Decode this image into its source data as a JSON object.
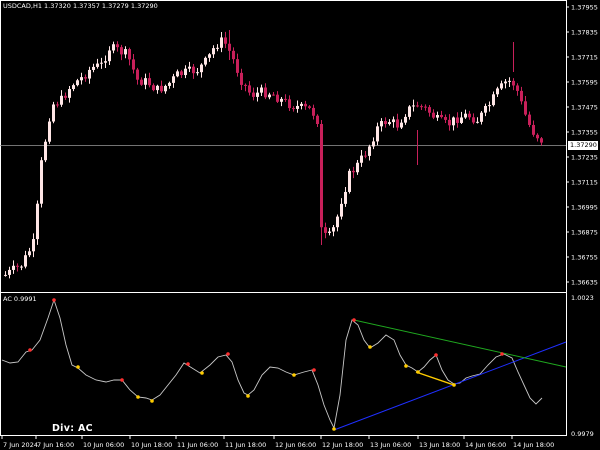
{
  "main_chart": {
    "symbol_info": "USDCAD,H1  1.37320 1.37357 1.37279 1.37290",
    "current_price": "1.37290",
    "price_labels": [
      "1.37955",
      "1.37835",
      "1.37715",
      "1.37595",
      "1.37475",
      "1.37355",
      "1.37235",
      "1.37115",
      "1.36995",
      "1.36875",
      "1.36755",
      "1.36635"
    ],
    "ylim": [
      1.366,
      1.38
    ],
    "bull_color": "#ffe6e6",
    "bear_color": "#c8205a"
  },
  "indicator": {
    "label": "AC 0.9991",
    "top_label": "1.0023",
    "bottom_label": "0.9979",
    "div_text": "Div:  AC",
    "line_color": "#c8c8c8",
    "peak_marker_color": "#ff3030",
    "trough_marker_color": "#ffcc00",
    "trendlines": [
      {
        "color": "#1f2fff"
      },
      {
        "color": "#1fa81f"
      },
      {
        "color": "#ffcc00"
      }
    ]
  },
  "x_axis": {
    "labels": [
      "7 Jun 2024",
      "7 Jun 16:00",
      "10 Jun 06:00",
      "10 Jun 18:00",
      "11 Jun 06:00",
      "11 Jun 18:00",
      "12 Jun 06:00",
      "12 Jun 18:00",
      "13 Jun 06:00",
      "13 Jun 18:00",
      "14 Jun 06:00",
      "14 Jun 18:00"
    ]
  }
}
